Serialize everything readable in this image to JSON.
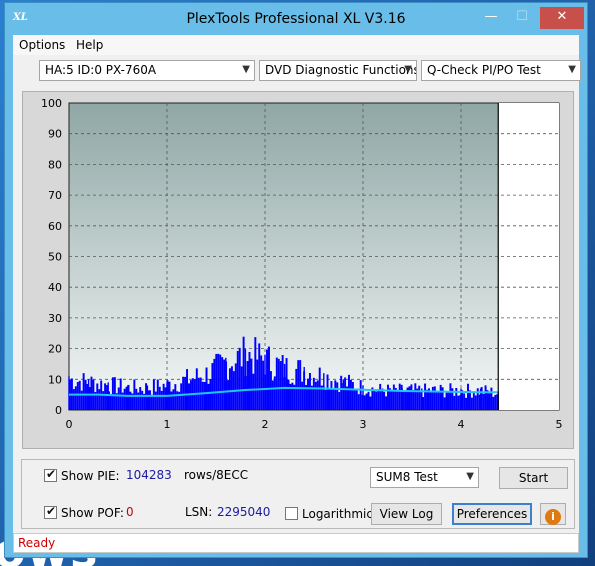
{
  "window": {
    "title": "PlexTools Professional XL V3.16",
    "app_icon_text": "XL",
    "minimize_glyph": "—",
    "maximize_glyph": "☐",
    "close_glyph": "✕"
  },
  "desktop": {
    "partial_text": "ows"
  },
  "menu": {
    "options": "Options",
    "help": "Help"
  },
  "selectors": {
    "drive": "HA:5 ID:0  PX-760A",
    "function": "DVD Diagnostic Functions",
    "test": "Q-Check PI/PO Test",
    "arrow_glyph": "▼"
  },
  "controls": {
    "show_pie_label": "Show PIE:",
    "show_pie_checked": true,
    "pie_value": "104283",
    "pie_unit": "rows/8ECC",
    "show_poe_label": "Show POF:",
    "show_poe_checked": true,
    "poe_value": "0",
    "lsn_label": "LSN:",
    "lsn_value": "2295040",
    "log_label": "Logarithmic",
    "log_checked": false,
    "sum_select": "SUM8 Test",
    "start_button": "Start",
    "view_log_button": "View Log",
    "preferences_button": "Preferences",
    "info_icon_glyph": "i"
  },
  "status": {
    "text": "Ready"
  },
  "colors": {
    "pie_bars": "#0000ff",
    "average_line": "#1ec8f0",
    "status_text": "#cc0000",
    "value_text": "#1a1aa0",
    "poe_value": "#cc0000"
  },
  "chart_data": {
    "type": "bar",
    "xlim": [
      0,
      5
    ],
    "ylim": [
      0,
      100
    ],
    "x_ticks": [
      0,
      1,
      2,
      3,
      4,
      5
    ],
    "y_ticks": [
      0,
      10,
      20,
      30,
      40,
      50,
      60,
      70,
      80,
      90,
      100
    ],
    "grid": true,
    "end_marker_x": 4.38,
    "series": [
      {
        "kind": "bars",
        "x": [
          0.0,
          0.2,
          0.4,
          0.6,
          0.8,
          1.0,
          1.2,
          1.4,
          1.6,
          1.8,
          2.0,
          2.2,
          2.4,
          2.6,
          2.8,
          3.0,
          3.2,
          3.4,
          3.6,
          3.8,
          4.0,
          4.2,
          4.38
        ],
        "y": [
          11,
          10,
          9,
          8,
          8,
          9,
          11,
          13,
          17,
          20,
          18,
          15,
          14,
          12,
          10,
          8,
          7,
          7,
          7,
          7,
          7,
          7,
          6
        ]
      },
      {
        "kind": "line",
        "x": [
          0.0,
          0.3,
          0.6,
          1.0,
          1.4,
          1.8,
          2.2,
          2.6,
          3.0,
          3.4,
          3.8,
          4.2,
          4.38
        ],
        "y": [
          5,
          5,
          4.6,
          4.6,
          5.5,
          6.5,
          7.2,
          7,
          6.6,
          6.2,
          6,
          5.8,
          5.8
        ]
      }
    ]
  }
}
